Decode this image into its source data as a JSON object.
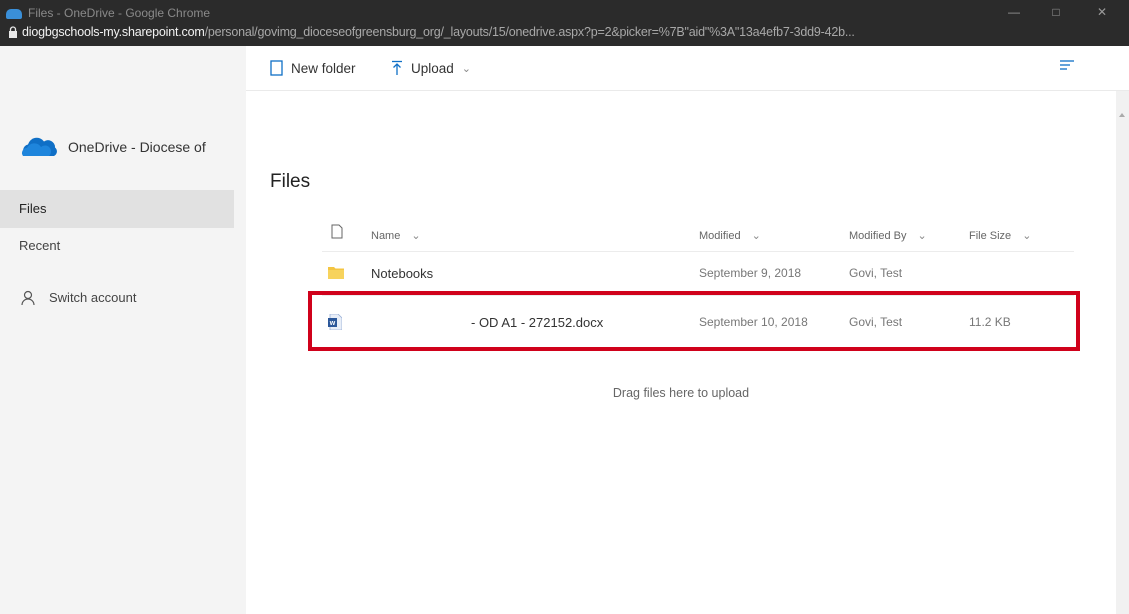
{
  "window": {
    "title": "Files - OneDrive - Google Chrome",
    "url_host": "diogbgschools-my.sharepoint.com",
    "url_path": "/personal/govimg_dioceseofgreensburg_org/_layouts/15/onedrive.aspx?p=2&picker=%7B\"aid\"%3A\"13a4efb7-3dd9-42b..."
  },
  "sidebar": {
    "account_label": "OneDrive - Diocese of",
    "items": [
      {
        "label": "Files"
      },
      {
        "label": "Recent"
      }
    ],
    "switch_account": "Switch account"
  },
  "toolbar": {
    "new_folder": "New folder",
    "upload": "Upload"
  },
  "main": {
    "title": "Files",
    "columns": {
      "name": "Name",
      "modified": "Modified",
      "modified_by": "Modified By",
      "file_size": "File Size"
    },
    "rows": [
      {
        "name": "Notebooks",
        "modified": "September 9, 2018",
        "modified_by": "Govi, Test",
        "size": ""
      },
      {
        "name": "- OD A1 - 272152.docx",
        "modified": "September 10, 2018",
        "modified_by": "Govi, Test",
        "size": "11.2 KB"
      }
    ],
    "drag_hint": "Drag files here to upload"
  },
  "colors": {
    "highlight": "#d0011b",
    "onedrive_blue": "#0f6fc6",
    "folder_yellow": "#f4c542",
    "word_blue": "#2b579a"
  }
}
